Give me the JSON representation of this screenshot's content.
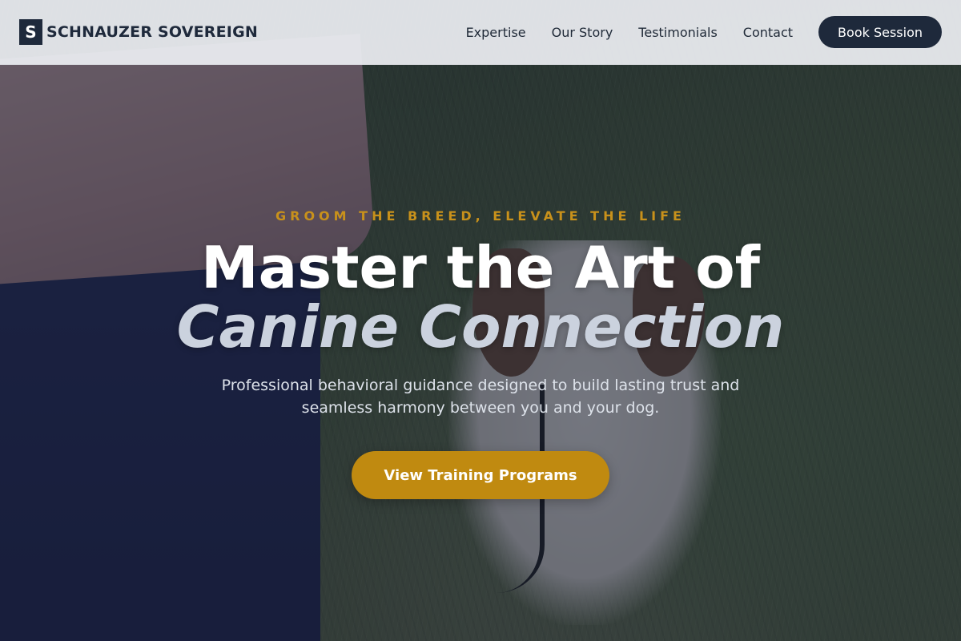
{
  "brand": {
    "mark": "S",
    "name": "SCHNAUZER SOVEREIGN"
  },
  "nav": {
    "links": [
      "Expertise",
      "Our Story",
      "Testimonials",
      "Contact"
    ],
    "cta_label": "Book Session"
  },
  "hero": {
    "eyebrow": "GROOM THE BREED, ELEVATE THE LIFE",
    "headline_line1": "Master the Art of",
    "headline_line2": "Canine Connection",
    "subtext": "Professional behavioral guidance designed to build lasting trust and seamless harmony between you and your dog.",
    "cta_label": "View Training Programs"
  },
  "colors": {
    "navy": "#1e293b",
    "gold": "#c08a10",
    "eyebrow_gold": "#c8911b"
  }
}
